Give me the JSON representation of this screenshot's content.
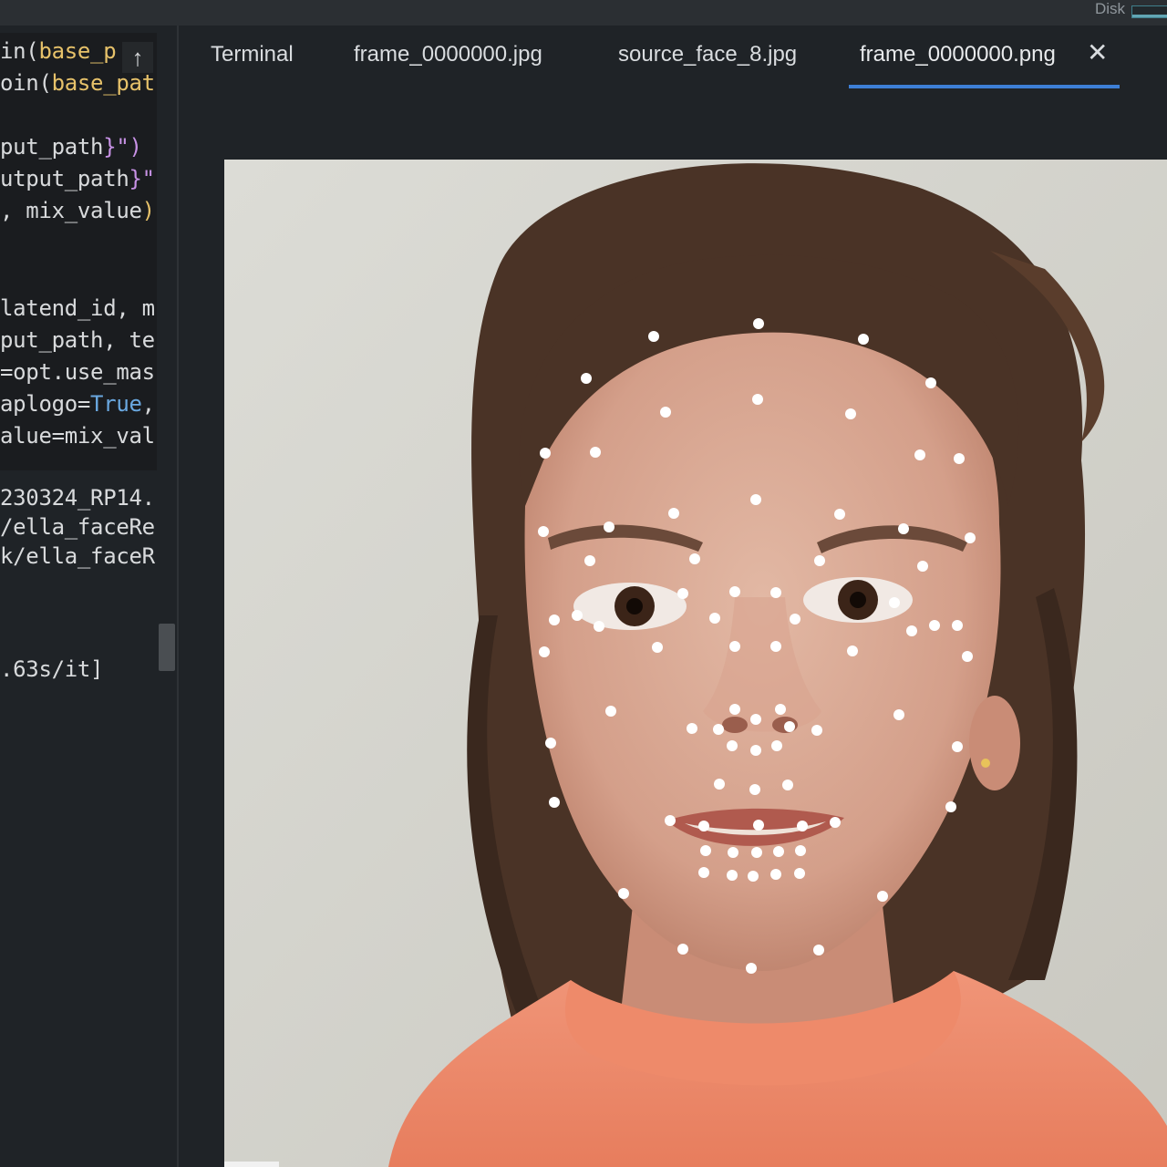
{
  "status_bar": {
    "disk_label": "Disk"
  },
  "code_editor": {
    "lines": [
      {
        "pre": "in(",
        "mid": "base_p",
        "post": ""
      },
      {
        "pre": "oin(",
        "mid": "base_pat",
        "post": ""
      },
      {
        "pre": "",
        "mid": "",
        "post": ""
      },
      {
        "pre": "put_path",
        "mid": "}\")",
        "post": ""
      },
      {
        "pre": "utput_path",
        "mid": "}\"",
        "post": ""
      },
      {
        "pre": ", mix_value",
        "mid": ")",
        "post": ""
      },
      {
        "pre": "",
        "mid": "",
        "post": ""
      },
      {
        "pre": "",
        "mid": "",
        "post": ""
      },
      {
        "pre": "latend_id, m",
        "mid": "",
        "post": ""
      },
      {
        "pre": "put_path, te",
        "mid": "",
        "post": ""
      },
      {
        "pre": "=opt.use_mas",
        "mid": "",
        "post": ""
      },
      {
        "pre": "aplogo=",
        "mid": "True",
        "post": ","
      },
      {
        "pre": "alue=mix_val",
        "mid": "",
        "post": ""
      }
    ],
    "scroll_up_icon": "arrow-up-icon"
  },
  "terminal": {
    "lines": [
      "230324_RP14.",
      "/ella_faceRe",
      "k/ella_faceR",
      "",
      "",
      "",
      ".63s/it]"
    ]
  },
  "tabs": [
    {
      "label": "Terminal",
      "active": false
    },
    {
      "label": "frame_0000000.jpg",
      "active": false
    },
    {
      "label": "source_face_8.jpg",
      "active": false
    },
    {
      "label": "frame_0000000.png",
      "active": true
    }
  ],
  "tab_close_symbol": "✕",
  "colors": {
    "accent_tab_underline": "#3d7fd6",
    "editor_bg": "#1a1c1f",
    "panel_bg": "#1f2327",
    "landmark_dot": "#ffffff",
    "sweater": "#f08a6c",
    "wall": "#d9d8d2"
  }
}
